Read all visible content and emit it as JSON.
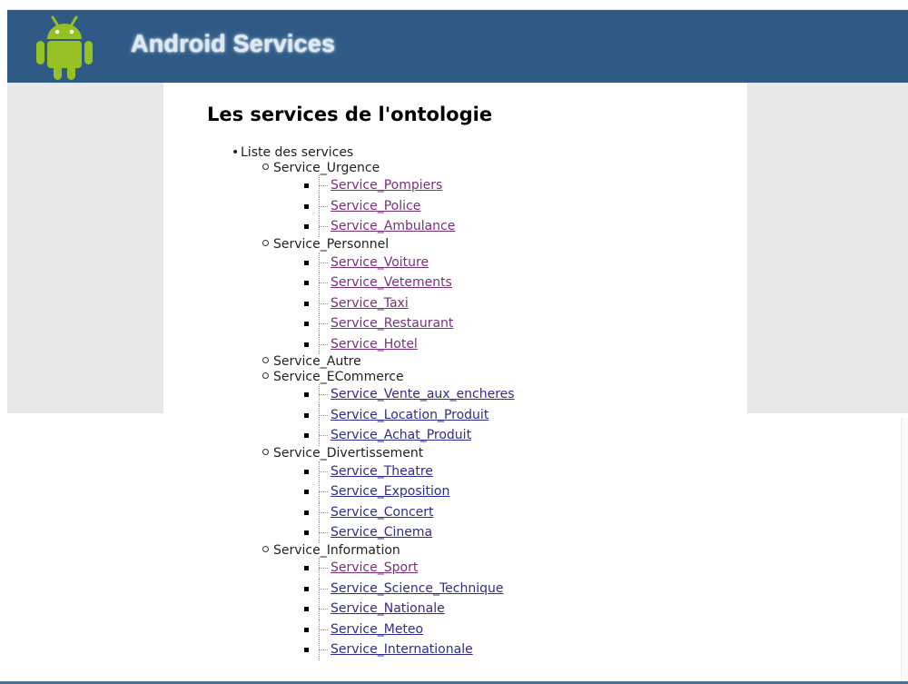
{
  "header": {
    "brand": "Android Services",
    "logo_icon": "android-robot-icon",
    "bg_color": "#2f5a85"
  },
  "page": {
    "title": "Les services de l'ontologie"
  },
  "tree": {
    "root_label": "Liste des services",
    "categories": [
      {
        "name": "Service_Urgence",
        "links": [
          "Service_Pompiers",
          "Service_Police",
          "Service_Ambulance"
        ]
      },
      {
        "name": "Service_Personnel",
        "links": [
          "Service_Voiture",
          "Service_Vetements",
          "Service_Taxi",
          "Service_Restaurant",
          "Service_Hotel"
        ]
      },
      {
        "name": "Service_Autre",
        "links": []
      },
      {
        "name": "Service_ECommerce",
        "links": [
          "Service_Vente_aux_encheres",
          "Service_Location_Produit",
          "Service_Achat_Produit"
        ]
      },
      {
        "name": "Service_Divertissement",
        "links": [
          "Service_Theatre",
          "Service_Exposition",
          "Service_Concert",
          "Service_Cinema"
        ]
      },
      {
        "name": "Service_Information",
        "links": [
          "Service_Sport",
          "Service_Science_Technique",
          "Service_Nationale",
          "Service_Meteo",
          "Service_Internationale"
        ]
      }
    ]
  }
}
